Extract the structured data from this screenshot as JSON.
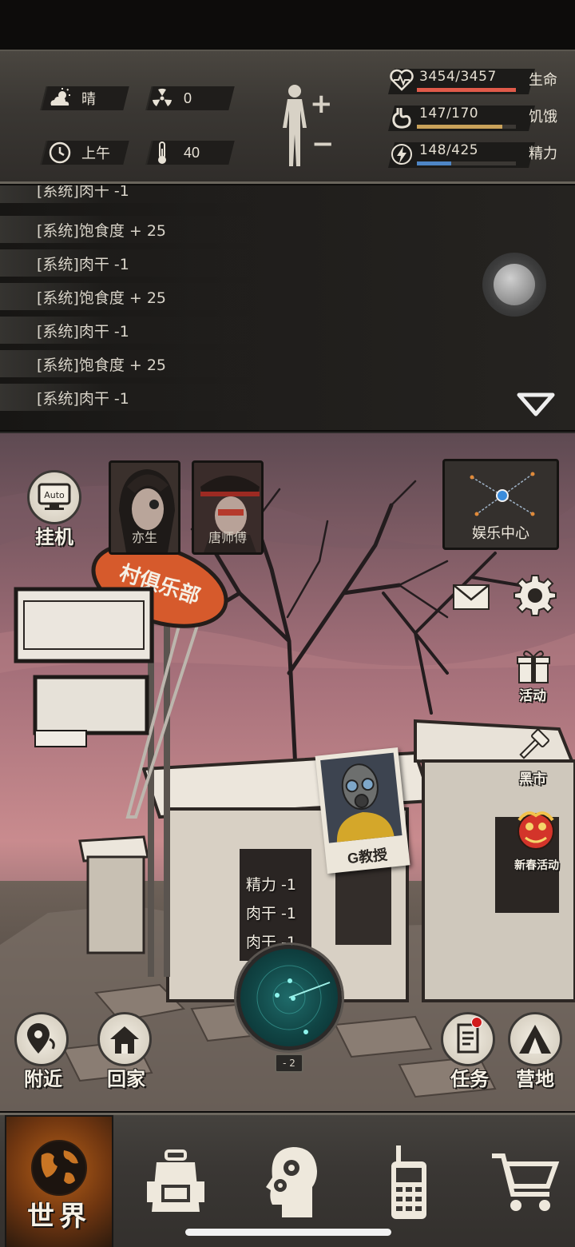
{
  "status": {
    "weather": {
      "icon": "cloud-sun-icon",
      "label": "晴"
    },
    "radiation": {
      "icon": "radiation-icon",
      "value": "0"
    },
    "time": {
      "icon": "clock-icon",
      "label": "上午"
    },
    "temperature": {
      "icon": "thermometer-icon",
      "value": "40"
    },
    "stats": [
      {
        "name": "生命",
        "value": "3454/3457",
        "fraction": 0.999,
        "color": "#e05a4a",
        "icon": "heart-pulse-icon"
      },
      {
        "name": "饥饿",
        "value": "147/170",
        "fraction": 0.865,
        "color": "#c9a25a",
        "icon": "stomach-icon"
      },
      {
        "name": "精力",
        "value": "148/425",
        "fraction": 0.348,
        "color": "#4e86c6",
        "icon": "lightning-icon"
      }
    ]
  },
  "log": {
    "lines": [
      "[系统]肉干 -1",
      "[系统]饱食度 + 25",
      "[系统]肉干 -1",
      "[系统]饱食度 + 25",
      "[系统]肉干 -1",
      "[系统]饱食度 + 25",
      "[系统]肉干 -1"
    ]
  },
  "scene": {
    "auto_button": {
      "badge": "Auto",
      "label": "挂机"
    },
    "npcs": [
      {
        "name": "亦生"
      },
      {
        "name": "唐师傅"
      }
    ],
    "minimap": {
      "label": "娱乐中心"
    },
    "sign_text": "村俱乐部",
    "side_buttons": [
      {
        "label": "活动",
        "icon": "gift-icon"
      },
      {
        "label": "黑市",
        "icon": "gavel-icon"
      },
      {
        "label": "新春活动",
        "icon": "lion-dance-icon"
      }
    ],
    "professor": {
      "label": "G教授"
    },
    "float_messages": [
      "精力 -1",
      "肉干 -1",
      "肉干 -1"
    ],
    "radar_badge": "- 2",
    "bottom_left": [
      {
        "label": "附近",
        "icon": "location-icon"
      },
      {
        "label": "回家",
        "icon": "home-icon"
      }
    ],
    "bottom_right": [
      {
        "label": "任务",
        "icon": "task-icon"
      },
      {
        "label": "营地",
        "icon": "tent-icon"
      }
    ]
  },
  "tabs": [
    {
      "label": "世界",
      "icon": "globe-icon",
      "active": true
    },
    {
      "icon": "backpack-icon"
    },
    {
      "icon": "head-gears-icon"
    },
    {
      "icon": "walkie-talkie-icon"
    },
    {
      "icon": "shopping-cart-icon"
    }
  ]
}
